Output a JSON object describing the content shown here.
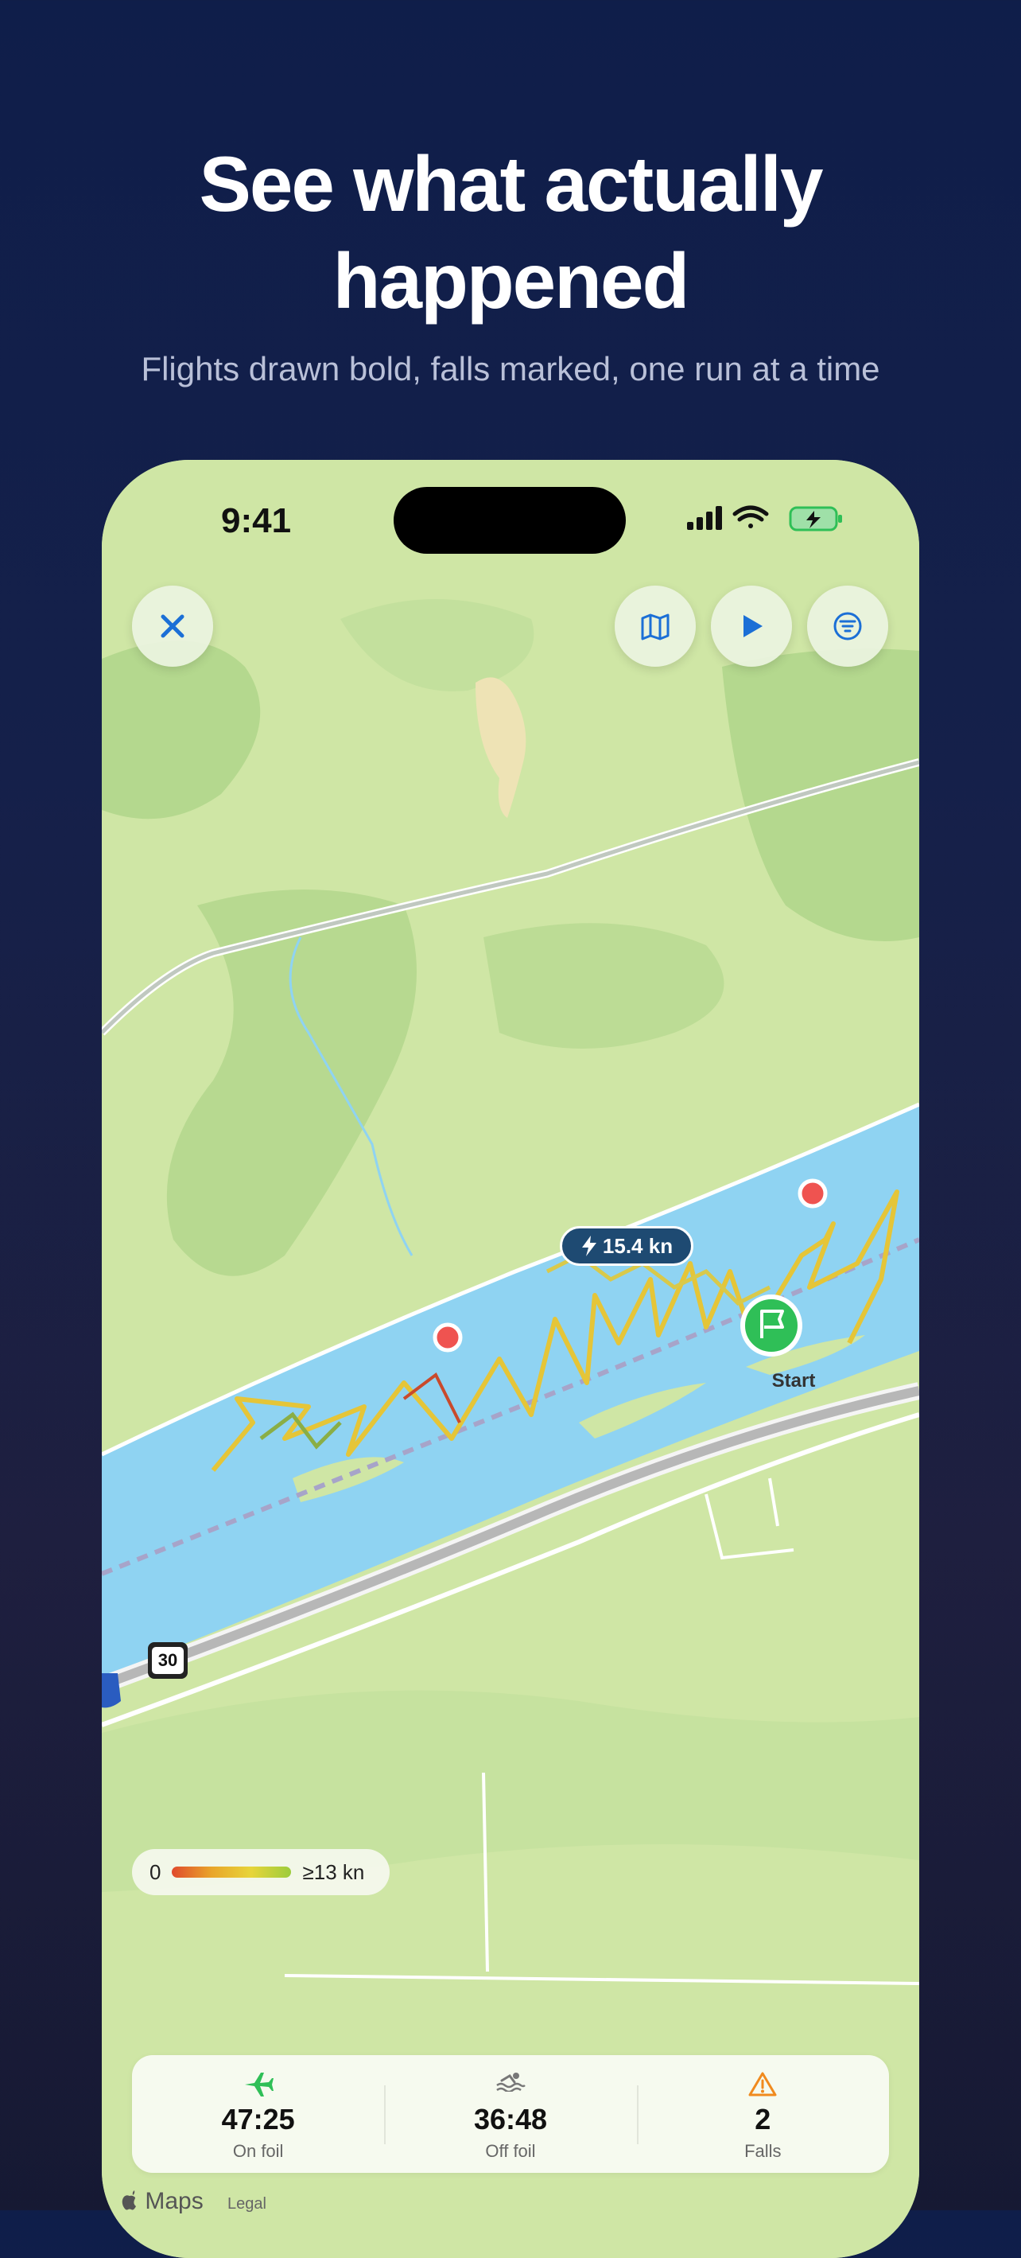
{
  "headline": {
    "line1": "See what actually",
    "line2": "happened"
  },
  "subhead": "Flights drawn bold, falls marked, one run at a time",
  "status_bar": {
    "time": "9:41"
  },
  "map_buttons": {
    "close_icon": "close-icon",
    "map_icon": "map-icon",
    "play_icon": "play-icon",
    "filter_icon": "filter-icon"
  },
  "speed_marker": {
    "label": "15.4 kn",
    "icon": "bolt-icon"
  },
  "start_marker": {
    "label": "Start",
    "icon": "flag-icon"
  },
  "route_shield": "30",
  "speed_legend": {
    "min": "0",
    "max": "≥13 kn"
  },
  "stats": [
    {
      "value": "47:25",
      "label": "On foil",
      "icon": "plane-icon",
      "color": "#2fbf57"
    },
    {
      "value": "36:48",
      "label": "Off foil",
      "icon": "swim-icon",
      "color": "#777777"
    },
    {
      "value": "2",
      "label": "Falls",
      "icon": "warning-icon",
      "color": "#f08a1e"
    }
  ],
  "footer": {
    "brand": "Maps",
    "legal": "Legal"
  },
  "colors": {
    "background": "#0f1e4a",
    "water": "#8fd3f2",
    "land": "#cfe6a5",
    "fall_marker": "#ef5350",
    "start_marker": "#2fbf57"
  }
}
